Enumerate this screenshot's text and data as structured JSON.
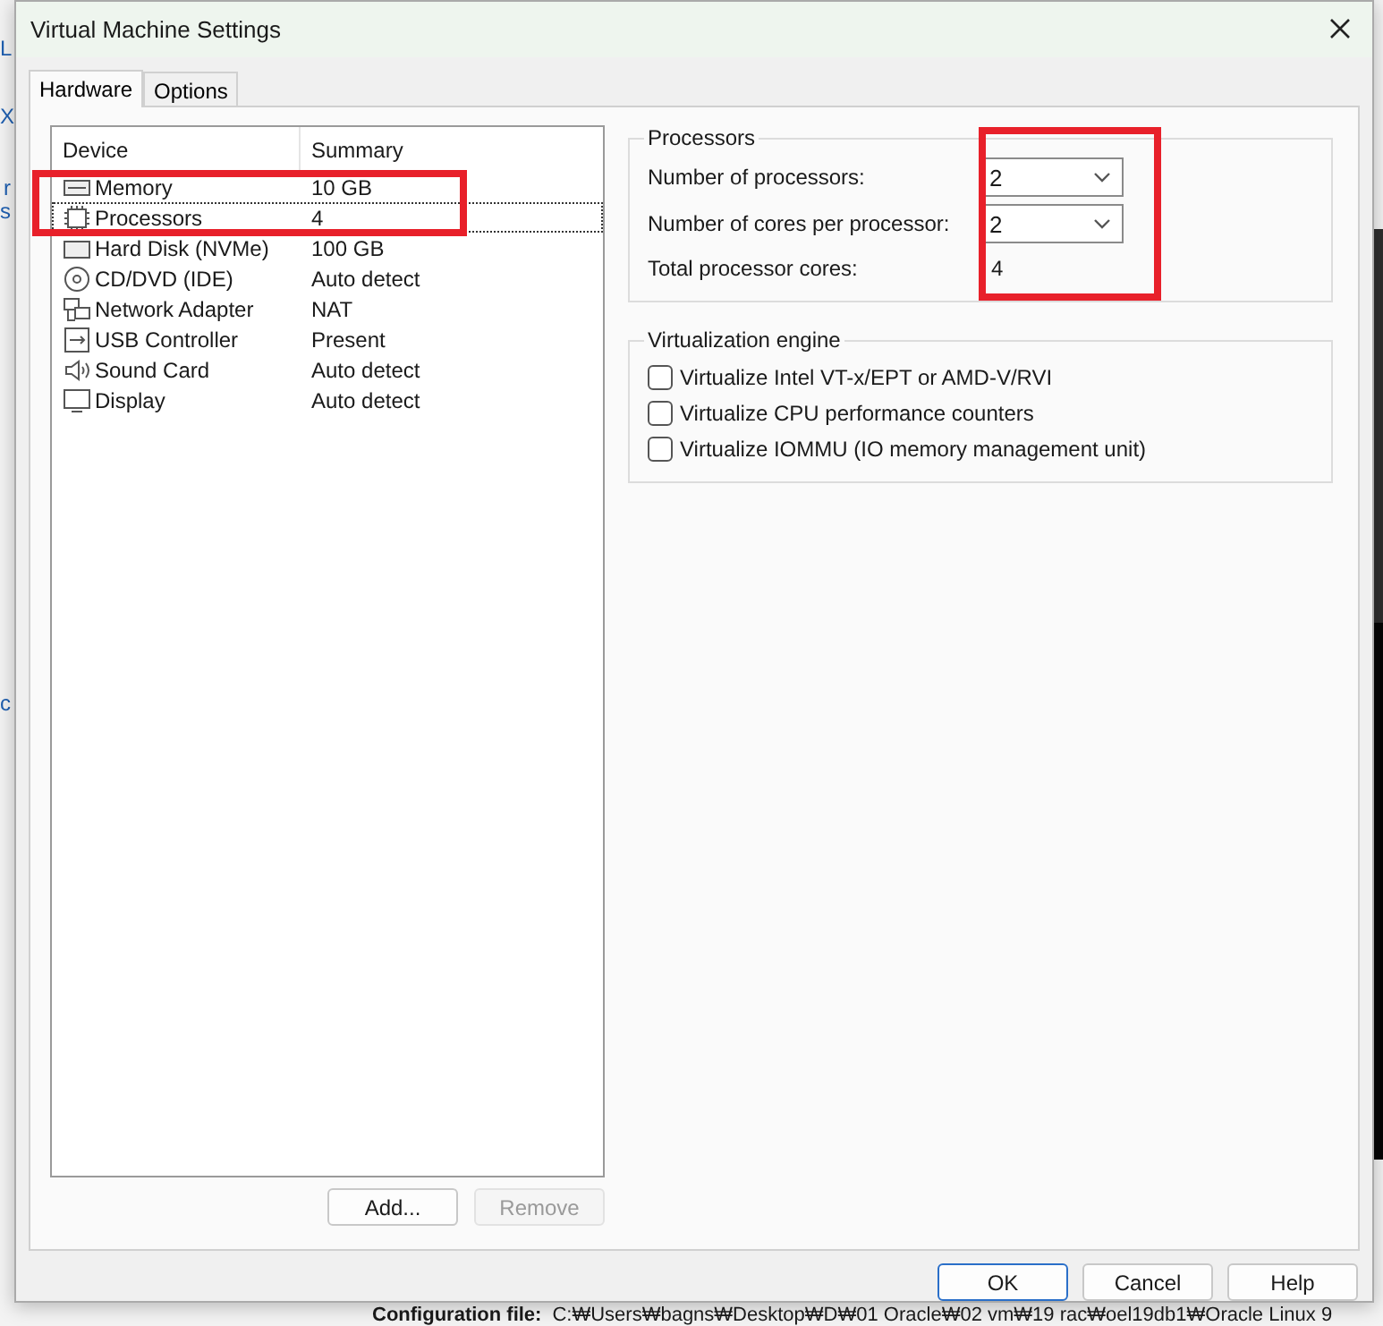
{
  "background": {
    "fragments": [
      "L",
      "X",
      "r",
      "s",
      "c"
    ],
    "config_label": "Configuration file:",
    "config_path": "C:₩Users₩bagns₩Desktop₩D₩01 Oracle₩02 vm₩19 rac₩oel19db1₩Oracle Linux 9"
  },
  "window": {
    "title": "Virtual Machine Settings"
  },
  "tabs": [
    {
      "label": "Hardware",
      "selected": true
    },
    {
      "label": "Options",
      "selected": false
    }
  ],
  "device_list": {
    "columns": [
      "Device",
      "Summary"
    ],
    "rows": [
      {
        "kind": "memory",
        "device": "Memory",
        "summary": "10 GB",
        "selected": false
      },
      {
        "kind": "processor",
        "device": "Processors",
        "summary": "4",
        "selected": true
      },
      {
        "kind": "disk",
        "device": "Hard Disk (NVMe)",
        "summary": "100 GB",
        "selected": false
      },
      {
        "kind": "cd",
        "device": "CD/DVD (IDE)",
        "summary": "Auto detect",
        "selected": false
      },
      {
        "kind": "network",
        "device": "Network Adapter",
        "summary": "NAT",
        "selected": false
      },
      {
        "kind": "usb",
        "device": "USB Controller",
        "summary": "Present",
        "selected": false
      },
      {
        "kind": "sound",
        "device": "Sound Card",
        "summary": "Auto detect",
        "selected": false
      },
      {
        "kind": "display",
        "device": "Display",
        "summary": "Auto detect",
        "selected": false
      }
    ],
    "buttons": [
      {
        "label": "Add...",
        "disabled": false
      },
      {
        "label": "Remove",
        "disabled": true
      }
    ]
  },
  "processors": {
    "title": "Processors",
    "number_label": "Number of processors:",
    "number_value": "2",
    "cores_label": "Number of cores per processor:",
    "cores_value": "2",
    "total_label": "Total processor cores:",
    "total_value": "4"
  },
  "virtualization": {
    "title": "Virtualization engine",
    "options": [
      {
        "label": "Virtualize Intel VT-x/EPT or AMD-V/RVI",
        "checked": false
      },
      {
        "label": "Virtualize CPU performance counters",
        "checked": false
      },
      {
        "label": "Virtualize IOMMU (IO memory management unit)",
        "checked": false
      }
    ]
  },
  "footer_buttons": [
    {
      "label": "OK",
      "default": true
    },
    {
      "label": "Cancel",
      "default": false
    },
    {
      "label": "Help",
      "default": false
    }
  ]
}
